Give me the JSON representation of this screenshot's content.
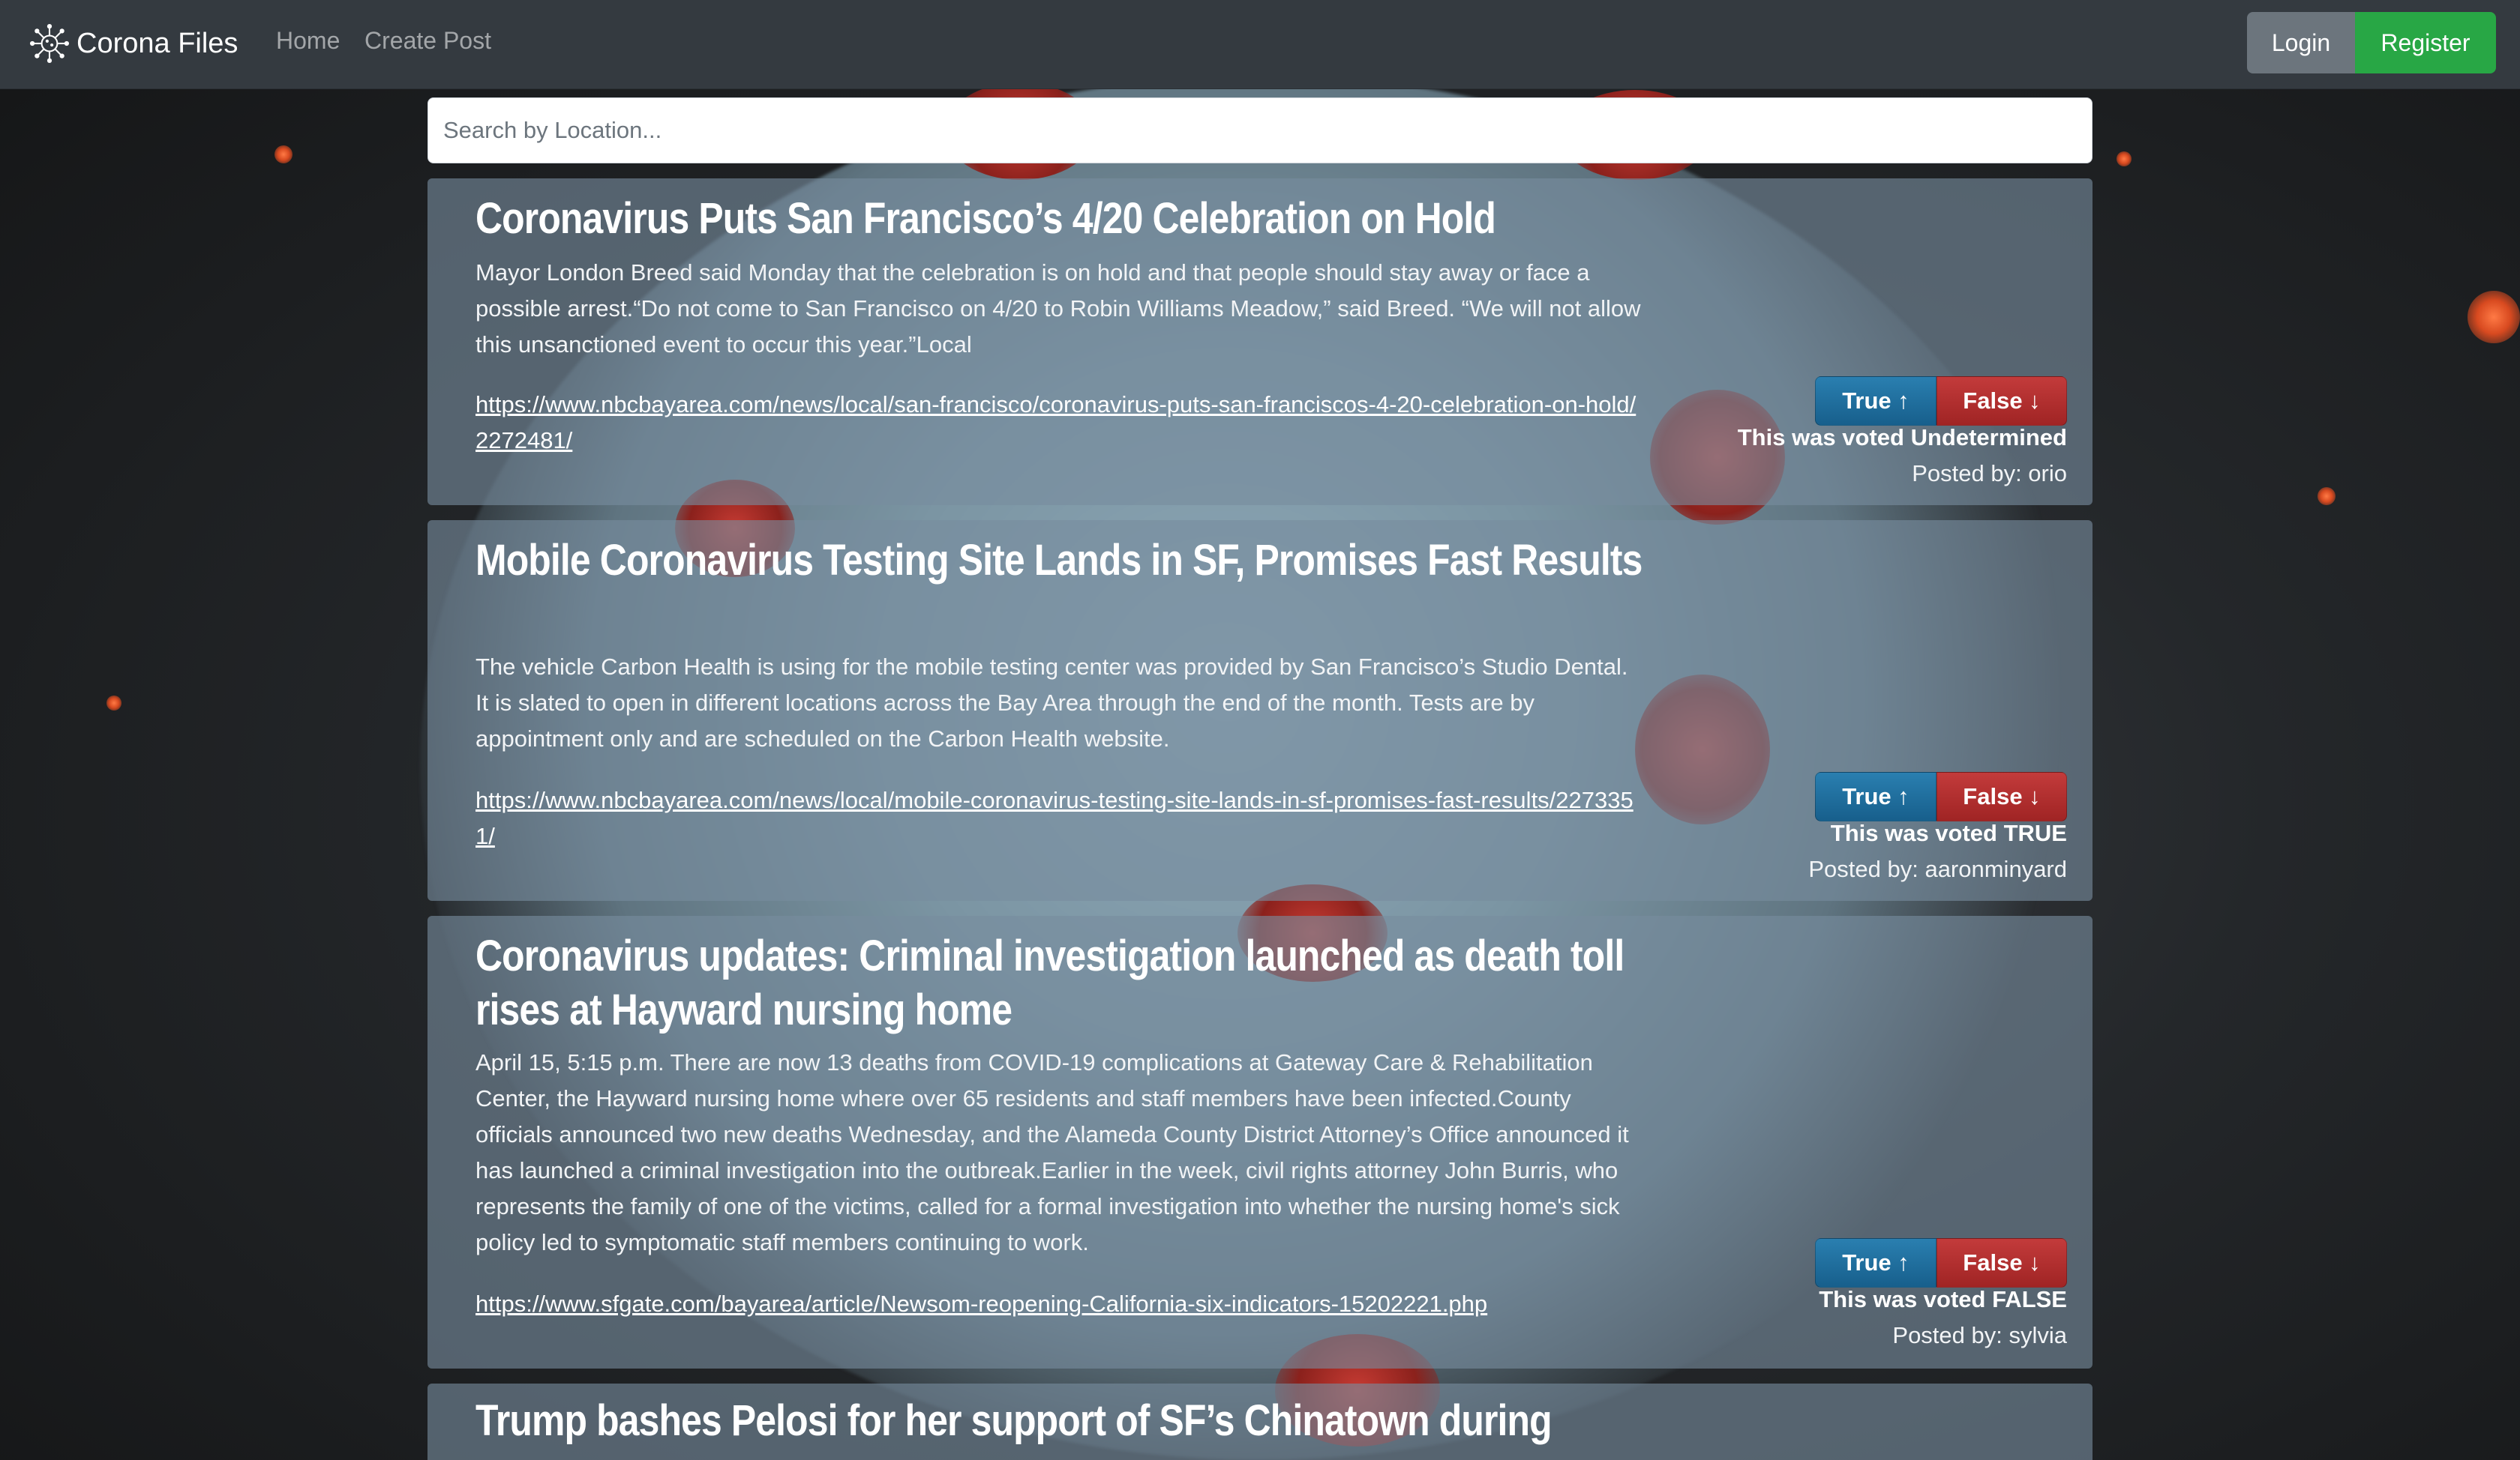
{
  "navbar": {
    "brand": "Corona Files",
    "links": [
      "Home",
      "Create Post"
    ],
    "login_label": "Login",
    "register_label": "Register"
  },
  "search": {
    "placeholder": "Search by Location..."
  },
  "vote_labels": {
    "true": "True ↑",
    "false": "False ↓"
  },
  "posts": [
    {
      "title": "Coronavirus Puts San Francisco’s 4/20 Celebration on Hold",
      "body": "Mayor London Breed said Monday that the celebration is on hold and that people should stay away or face a possible arrest.“Do not come to San Francisco on 4/20 to Robin Williams Meadow,” said Breed. “We will not allow this unsanctioned event to occur this year.”Local",
      "link": "https://www.nbcbayarea.com/news/local/san-francisco/coronavirus-puts-san-franciscos-4-20-celebration-on-hold/2272481/",
      "vote_status": "This was voted Undetermined",
      "posted_by": "Posted by: orio"
    },
    {
      "title": "Mobile Coronavirus Testing Site Lands in SF, Promises Fast Results",
      "body": "The vehicle Carbon Health is using for the mobile testing center was provided by San Francisco’s Studio Dental. It is slated to open in different locations across the Bay Area through the end of the month. Tests are by appointment only and are scheduled on the Carbon Health website.",
      "link": "https://www.nbcbayarea.com/news/local/mobile-coronavirus-testing-site-lands-in-sf-promises-fast-results/2273351/",
      "vote_status": "This was voted TRUE",
      "posted_by": "Posted by: aaronminyard"
    },
    {
      "title": "Coronavirus updates: Criminal investigation launched as death toll rises at Hayward nursing home",
      "body": "April 15, 5:15 p.m. There are now 13 deaths from COVID-19 complications at Gateway Care & Rehabilitation Center, the Hayward nursing home where over 65 residents and staff members have been infected.County officials announced two new deaths Wednesday, and the Alameda County District Attorney’s Office announced it has launched a criminal investigation into the outbreak.Earlier in the week, civil rights attorney John Burris, who represents the family of one of the victims, called for a formal investigation into whether the nursing home's sick policy led to symptomatic staff members continuing to work.",
      "link": "https://www.sfgate.com/bayarea/article/Newsom-reopening-California-six-indicators-15202221.php",
      "vote_status": "This was voted FALSE",
      "posted_by": "Posted by: sylvia"
    },
    {
      "title": "Trump bashes Pelosi for her support of SF’s Chinatown during"
    }
  ]
}
